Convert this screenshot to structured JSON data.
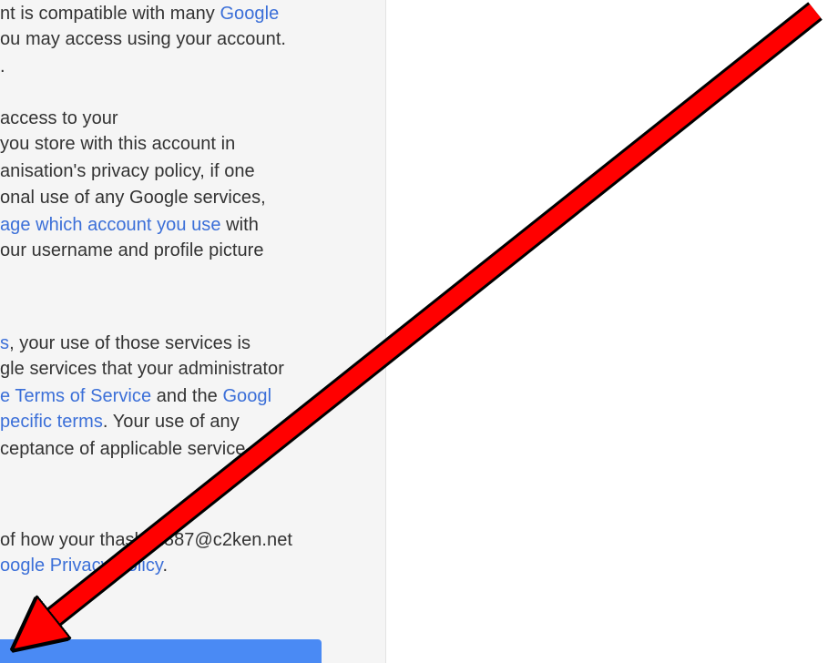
{
  "terms": {
    "lines": [
      [
        {
          "t": "nt is compatible with many "
        },
        {
          "t": "Google",
          "link": true
        }
      ],
      [
        {
          "t": "ou may access using your account."
        }
      ],
      [
        {
          "t": "."
        }
      ],
      [
        {
          "t": " access to your"
        }
      ],
      [
        {
          "t": " you store with this account in"
        }
      ],
      [
        {
          "t": "anisation's privacy policy, if one"
        }
      ],
      [
        {
          "t": "onal use of any Google services,"
        }
      ],
      [
        {
          "t": "age which account you use",
          "link": true
        },
        {
          "t": " with"
        }
      ],
      [
        {
          "t": "our username and profile picture"
        }
      ],
      [
        {
          "t": "s",
          "link": true
        },
        {
          "t": ", your use of those services is"
        }
      ],
      [
        {
          "t": "gle services that your administrator"
        }
      ],
      [
        {
          "t": "e Terms of Service",
          "link": true
        },
        {
          "t": " and the "
        },
        {
          "t": "Googl",
          "link": true
        }
      ],
      [
        {
          "t": "pecific terms",
          "link": true
        },
        {
          "t": ". Your use of any"
        }
      ],
      [
        {
          "t": "ceptance of applicable service-"
        }
      ],
      [
        {
          "t": "of how your thashim887@c2ken.net"
        }
      ],
      [
        {
          "t": "oogle Privacy Policy",
          "link": true
        },
        {
          "t": "."
        }
      ]
    ]
  },
  "accept_button": {
    "label": ""
  },
  "colors": {
    "link": "#3b6fd8",
    "text": "#333333",
    "panel_bg": "#f5f5f5",
    "button": "#4a8af4",
    "arrow": "#ff0000"
  },
  "annotation": {
    "icon": "red-arrow-icon"
  }
}
